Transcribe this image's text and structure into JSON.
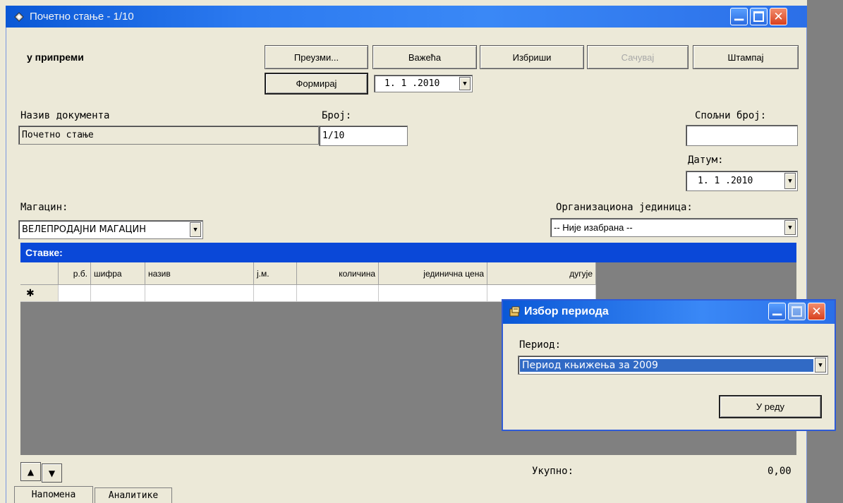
{
  "window": {
    "title": "Почетно стање - 1/10"
  },
  "toolbar": {
    "status": "у припреми",
    "preuzmi": "Преузми...",
    "vazeca": "Важећа",
    "izbrisi": "Избриши",
    "sacuvaj": "Сачувај",
    "stampaj": "Штампај",
    "formiraj": "Формирај",
    "date": "1. 1 .2010"
  },
  "form": {
    "naziv_label": "Назив документа",
    "naziv_value": "Почетно стање",
    "broj_label": "Број:",
    "broj_value": "1/10",
    "spoljni_label": "Спољни број:",
    "spoljni_value": "",
    "datum_label": "Датум:",
    "datum_value": "1. 1 .2010",
    "magacin_label": "Магацин:",
    "magacin_value": "ВЕЛЕПРОДАЈНИ МАГАЦИН",
    "org_label": "Организациона јединица:",
    "org_value": "-- Није изабрана --"
  },
  "grid": {
    "title": "Ставке:",
    "columns": [
      "р.б.",
      "шифра",
      "назив",
      "ј.м.",
      "количина",
      "јединична цена",
      "дугује"
    ],
    "new_row_marker": "✱"
  },
  "footer": {
    "ukupno_label": "Укупно:",
    "ukupno_value": "0,00",
    "tabs": [
      "Напомена",
      "Аналитике"
    ]
  },
  "dialog": {
    "title": "Избор периода",
    "period_label": "Период:",
    "period_value": "Период књижења за 2009",
    "ok": "У реду"
  }
}
